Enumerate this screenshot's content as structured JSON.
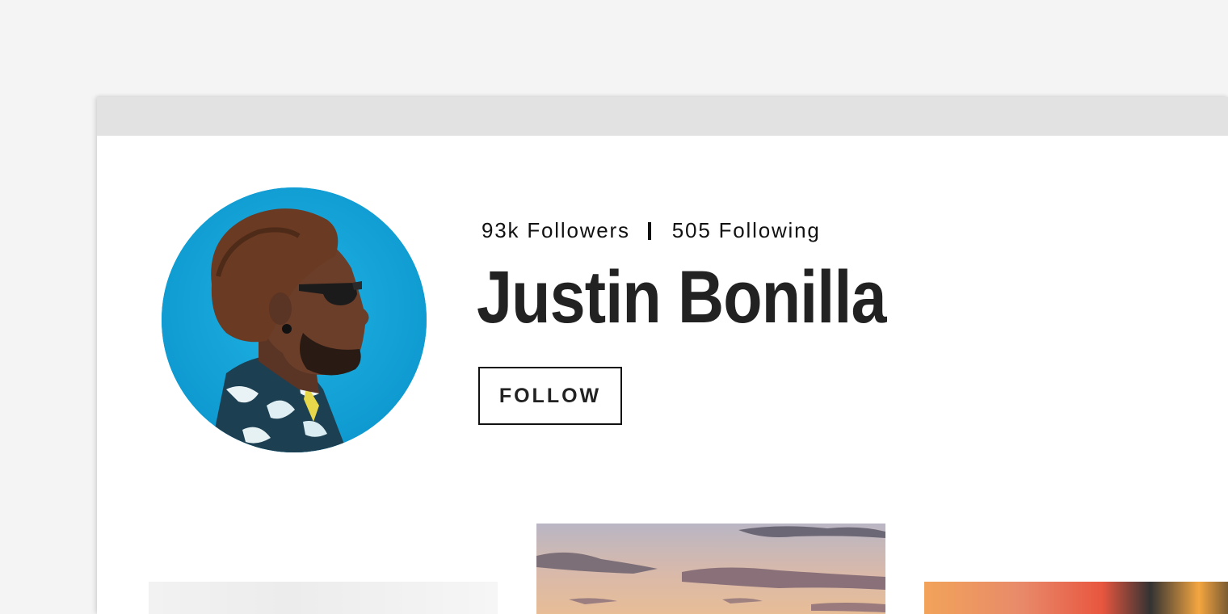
{
  "profile": {
    "followers_label": "93k Followers",
    "following_label": "505 Following",
    "name": "Justin Bonilla",
    "follow_button": "FOLLOW"
  },
  "colors": {
    "background": "#f4f4f4",
    "titlebar": "#e2e2e2",
    "avatar_bg": "#0ea6dc",
    "text": "#222222"
  }
}
